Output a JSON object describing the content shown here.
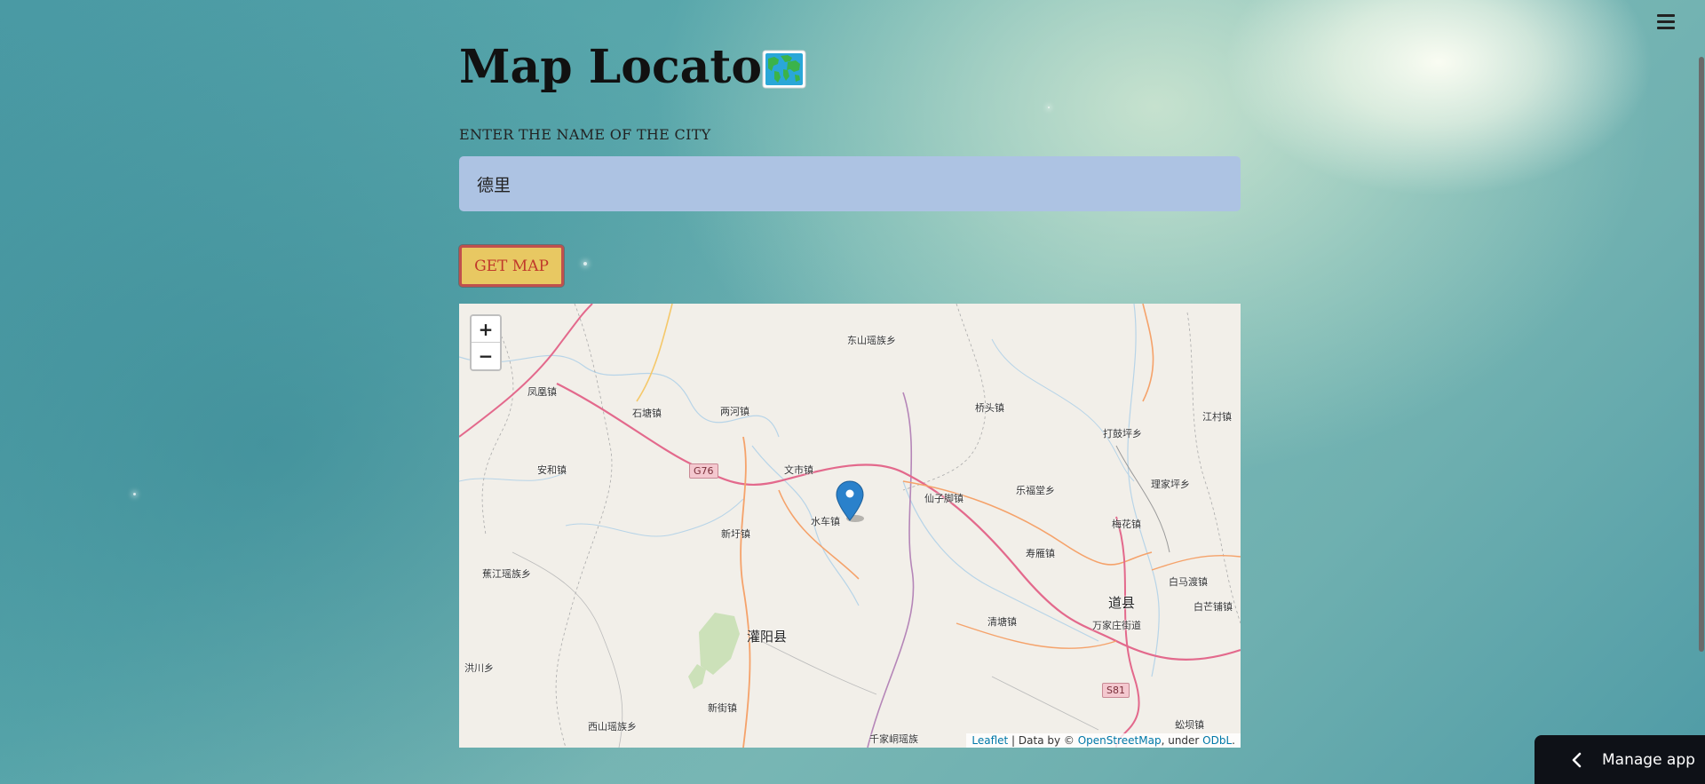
{
  "page": {
    "title": "Map Locator",
    "title_emoji_icon": "world-map-icon"
  },
  "form": {
    "city_label": "ENTER THE NAME OF THE CITY",
    "city_value": "德里",
    "submit_label": "GET MAP"
  },
  "map": {
    "zoom_in_label": "+",
    "zoom_out_label": "−",
    "marker_icon": "map-pin-icon",
    "places": [
      "东山瑶族乡",
      "凤凰镇",
      "石塘镇",
      "两河镇",
      "桥头镇",
      "打鼓坪乡",
      "江村镇",
      "安和镇",
      "文市镇",
      "仙子脚镇",
      "乐福堂乡",
      "理家坪乡",
      "水车镇",
      "新圩镇",
      "梅花镇",
      "寿雁镇",
      "蕉江瑶族乡",
      "白马渡镇",
      "道县",
      "白芒铺镇",
      "灌阳县",
      "清塘镇",
      "万家庄街道",
      "洪川乡",
      "新街镇",
      "西山瑶族乡",
      "千家峒瑶族",
      "蚣坝镇"
    ],
    "road_shields": [
      "G76",
      "S81"
    ],
    "attribution": {
      "leaflet": "Leaflet",
      "separator": " | Data by © ",
      "osm": "OpenStreetMap",
      "under": ", under ",
      "odbl": "ODbL",
      "end": "."
    }
  },
  "footer": {
    "manage_app_label": "Manage app"
  },
  "colors": {
    "input_bg": "#adc3e3",
    "button_bg": "#e8c862",
    "button_border": "#c0504d",
    "button_text": "#c0392b",
    "map_bg": "#f2efe9",
    "marker_blue": "#2a81cb"
  }
}
